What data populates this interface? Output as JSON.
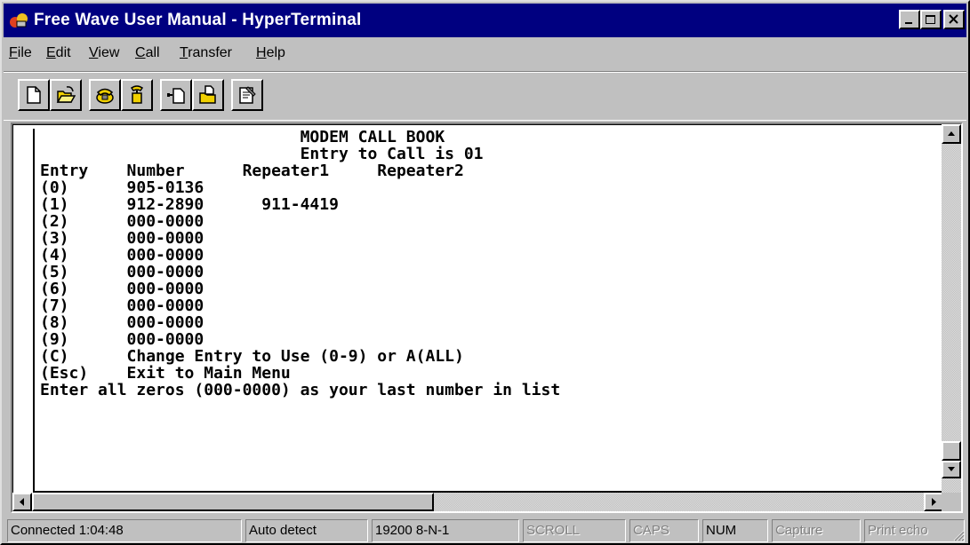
{
  "window": {
    "title": "Free Wave User Manual - HyperTerminal",
    "title_color": "#000080"
  },
  "title_buttons": [
    "minimize-icon",
    "maximize-icon",
    "close-icon"
  ],
  "menu": [
    {
      "pre": "",
      "key": "F",
      "post": "ile"
    },
    {
      "pre": "",
      "key": "E",
      "post": "dit"
    },
    {
      "pre": "",
      "key": "V",
      "post": "iew"
    },
    {
      "pre": "",
      "key": "C",
      "post": "all"
    },
    {
      "pre": "",
      "key": "T",
      "post": "ransfer"
    },
    {
      "pre": "",
      "key": "H",
      "post": "elp"
    }
  ],
  "toolbar": [
    "new-icon",
    "open-icon",
    "connect-icon",
    "disconnect-icon",
    "send-icon",
    "receive-icon",
    "properties-icon"
  ],
  "terminal": {
    "lines": [
      "                           MODEM CALL BOOK",
      "                           Entry to Call is 01",
      "Entry    Number      Repeater1     Repeater2",
      "(0)      905-0136",
      "(1)      912-2890      911-4419",
      "(2)      000-0000",
      "(3)      000-0000",
      "(4)      000-0000",
      "(5)      000-0000",
      "(6)      000-0000",
      "(7)      000-0000",
      "(8)      000-0000",
      "(9)      000-0000",
      "(C)      Change Entry to Use (0-9) or A(ALL)",
      "(Esc)    Exit to Main Menu",
      "Enter all zeros (000-0000) as your last number in list"
    ]
  },
  "status": {
    "connected": "Connected 1:04:48",
    "detect": "Auto detect",
    "settings": "19200 8-N-1",
    "scroll": "SCROLL",
    "caps": "CAPS",
    "num": "NUM",
    "capture": "Capture",
    "print_echo": "Print echo"
  }
}
